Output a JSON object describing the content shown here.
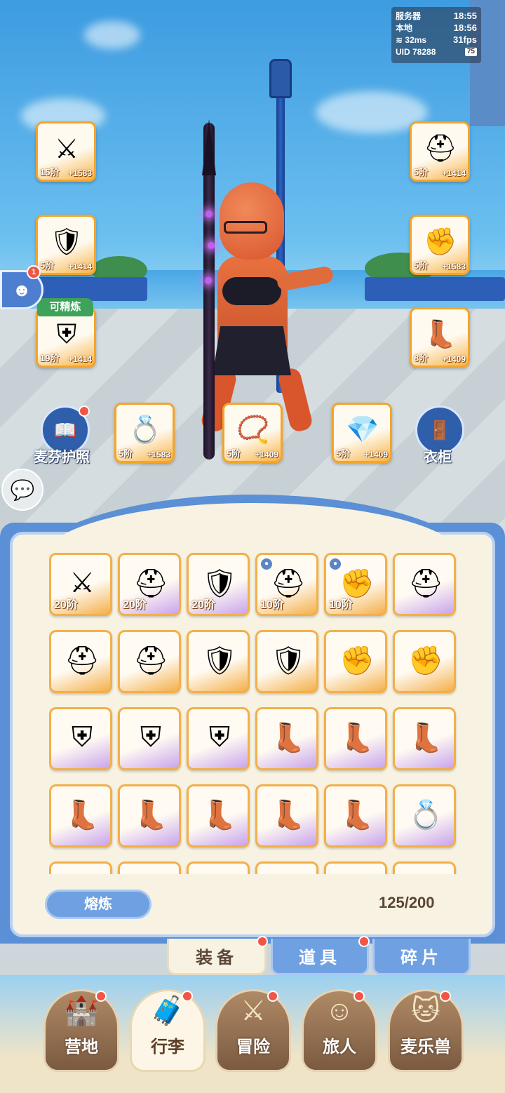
{
  "status": {
    "server_label": "服务器",
    "server_time": "18:55",
    "local_label": "本地",
    "local_time": "18:56",
    "ping": "32ms",
    "fps": "31fps",
    "uid": "UID 78288",
    "battery": "75"
  },
  "equipped": {
    "weapon": {
      "tier": "15阶",
      "bonus": "+1583",
      "icon": "spear-icon"
    },
    "chest": {
      "tier": "5阶",
      "bonus": "+1414",
      "icon": "chest-armor-icon"
    },
    "legs": {
      "tier": "19阶",
      "bonus": "+1414",
      "icon": "leg-armor-icon",
      "tag": "可精炼"
    },
    "helmet": {
      "tier": "5阶",
      "bonus": "+1414",
      "icon": "helmet-icon"
    },
    "gloves": {
      "tier": "5阶",
      "bonus": "+1583",
      "icon": "gloves-icon"
    },
    "boots": {
      "tier": "8阶",
      "bonus": "+1409",
      "icon": "boots-icon"
    },
    "ring": {
      "tier": "5阶",
      "bonus": "+1583",
      "icon": "ring-icon"
    },
    "necklace": {
      "tier": "5阶",
      "bonus": "+1409",
      "icon": "necklace-icon"
    },
    "amulet": {
      "tier": "5阶",
      "bonus": "+1409",
      "icon": "amulet-icon"
    }
  },
  "side_buttons": {
    "passport": "麦芬护照",
    "wardrobe": "衣柜",
    "bot_badge": "1"
  },
  "inventory": {
    "rows": [
      [
        {
          "icon": "spear-icon",
          "tier": "20阶",
          "lock": false,
          "rarity": "orange"
        },
        {
          "icon": "helmet-icon",
          "tier": "20阶",
          "lock": false,
          "rarity": "purple"
        },
        {
          "icon": "chest-armor-icon",
          "tier": "20阶",
          "lock": false,
          "rarity": "purple"
        },
        {
          "icon": "gold-helmet-icon",
          "tier": "10阶",
          "lock": true,
          "rarity": "orange"
        },
        {
          "icon": "gold-gauntlet-icon",
          "tier": "10阶",
          "lock": true,
          "rarity": "orange"
        },
        {
          "icon": "helmet-icon",
          "tier": "",
          "lock": false,
          "rarity": "purple"
        }
      ],
      [
        {
          "icon": "helmet-icon",
          "tier": "",
          "lock": false,
          "rarity": "orange"
        },
        {
          "icon": "helmet-icon",
          "tier": "",
          "lock": false,
          "rarity": "orange"
        },
        {
          "icon": "chest-armor-icon",
          "tier": "",
          "lock": false,
          "rarity": "orange"
        },
        {
          "icon": "chest-armor-icon",
          "tier": "",
          "lock": false,
          "rarity": "orange"
        },
        {
          "icon": "gloves-icon",
          "tier": "",
          "lock": false,
          "rarity": "orange"
        },
        {
          "icon": "gloves-icon",
          "tier": "",
          "lock": false,
          "rarity": "orange"
        }
      ],
      [
        {
          "icon": "leg-armor-icon",
          "tier": "",
          "lock": false,
          "rarity": "purple"
        },
        {
          "icon": "leg-armor-icon",
          "tier": "",
          "lock": false,
          "rarity": "purple"
        },
        {
          "icon": "leg-armor-icon",
          "tier": "",
          "lock": false,
          "rarity": "purple"
        },
        {
          "icon": "boots-icon",
          "tier": "",
          "lock": false,
          "rarity": "purple"
        },
        {
          "icon": "boots-icon",
          "tier": "",
          "lock": false,
          "rarity": "purple"
        },
        {
          "icon": "boots-icon",
          "tier": "",
          "lock": false,
          "rarity": "purple"
        }
      ],
      [
        {
          "icon": "boots-icon",
          "tier": "",
          "lock": false,
          "rarity": "purple"
        },
        {
          "icon": "boots-icon",
          "tier": "",
          "lock": false,
          "rarity": "purple"
        },
        {
          "icon": "boots-icon",
          "tier": "",
          "lock": false,
          "rarity": "purple"
        },
        {
          "icon": "boots-icon",
          "tier": "",
          "lock": false,
          "rarity": "purple"
        },
        {
          "icon": "boots-icon",
          "tier": "",
          "lock": false,
          "rarity": "purple"
        },
        {
          "icon": "ring-icon",
          "tier": "",
          "lock": false,
          "rarity": "purple"
        }
      ],
      [
        {
          "icon": "ring-icon",
          "tier": "",
          "lock": false,
          "rarity": "purple"
        },
        {
          "icon": "ring-icon",
          "tier": "",
          "lock": false,
          "rarity": "purple"
        },
        {
          "icon": "ring-icon",
          "tier": "",
          "lock": false,
          "rarity": "purple"
        },
        {
          "icon": "ring-icon",
          "tier": "",
          "lock": false,
          "rarity": "purple"
        },
        {
          "icon": "necklace-icon",
          "tier": "",
          "lock": false,
          "rarity": "purple"
        },
        {
          "icon": "necklace-icon",
          "tier": "",
          "lock": false,
          "rarity": "purple"
        }
      ]
    ],
    "smelt_label": "熔炼",
    "capacity": "125/200"
  },
  "tabs": [
    {
      "label": "装备",
      "active": true
    },
    {
      "label": "道具",
      "active": false
    },
    {
      "label": "碎片",
      "active": false
    }
  ],
  "nav": [
    {
      "label": "营地",
      "icon": "castle-icon",
      "active": false
    },
    {
      "label": "行李",
      "icon": "chest-icon",
      "active": true
    },
    {
      "label": "冒险",
      "icon": "crossed-swords-icon",
      "active": false
    },
    {
      "label": "旅人",
      "icon": "traveler-icon",
      "active": false
    },
    {
      "label": "麦乐兽",
      "icon": "pet-icon",
      "active": false
    }
  ],
  "colors": {
    "accent_blue": "#5b8fd6",
    "tab_blue": "#6fa0e2",
    "parchment": "#f8f2e2",
    "badge_red": "#f25544",
    "gold": "#f5a42a"
  }
}
